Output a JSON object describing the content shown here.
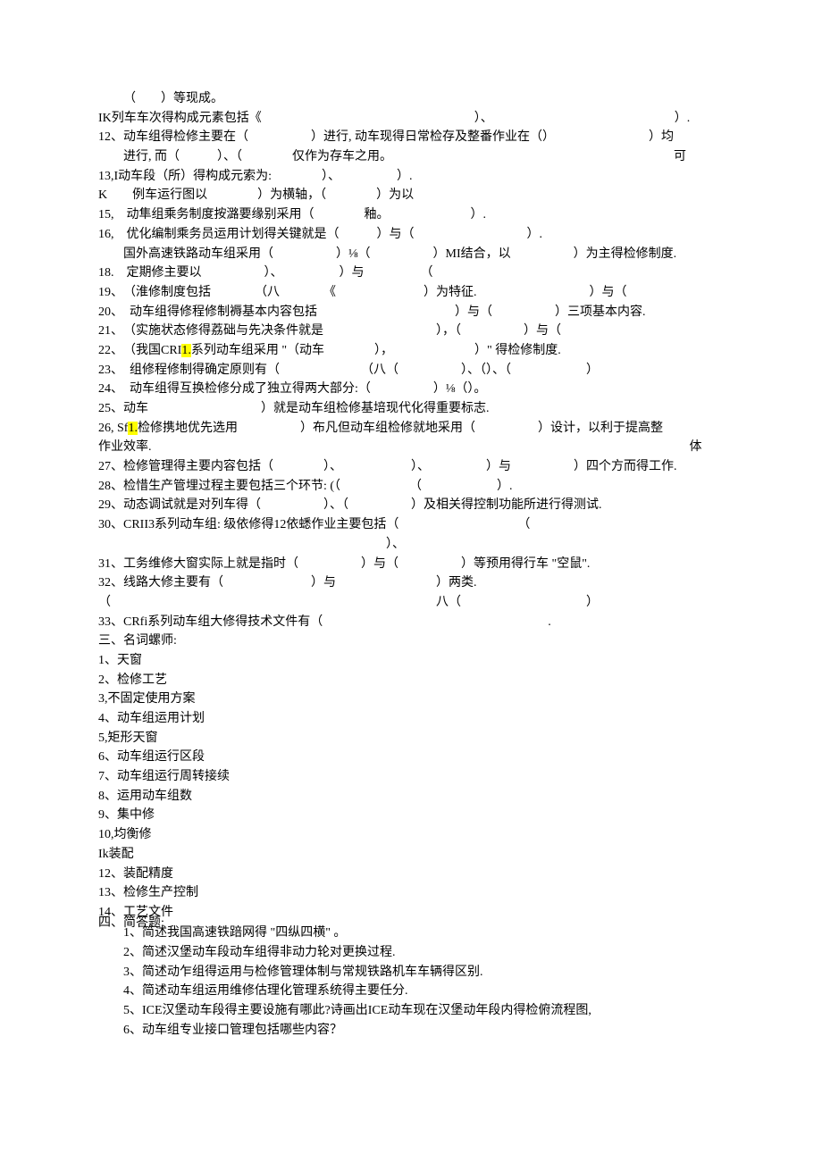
{
  "lines": {
    "l10b": "（　　）等现成。",
    "l11": "IK列车车次得构成元素包括《　　　　　　　　　　　　　　　　　）、　　　　　　　　　　　　　　　）.",
    "l12a": "12、动车组得检修主要在（　　　　　）进行, 动车现得日常检存及整番作业在（）　　　　　　　　）均",
    "l12b": "进行, 而（　　　）、（　　　　仅作为存车之用。　　　　　　　　　　　　　　　　　　　　　　　可",
    "l13": "13,I动车段（所）得构成元索为:　　　　）、　　　　　）.",
    "lK": "K　　例车运行图以　　　　）为横轴，（　　　　）为以",
    "l15": "15,　动隼组乘务制度按潞要缘别采用（　　　　釉。　　　　　　　）.",
    "l16": "16,　优化编制乘务员运用计划得关键就是（　　　）与（　　　　　　　　　）.",
    "l17": "　　国外高速铁路动车组采用（　　　　　）⅛（　　　　　）MI结合，以　　　　　）为主得检修制度.",
    "l18": "18.　定期修主要以　　　　　）、　　　　　）与　　　　　（",
    "l19": "19、　（淮修制度包括　　　　（八　　　　《　　　　　　　）为特征.　　　　　　　　　）与（",
    "l20": "20、　动车组得修程修制褥基本内容包括　　　　　　　　　　　）与（　　　　　）三项基本内容.",
    "l21": "21、　（实施状态修得荔础与先决条件就是　　　　　　　　　），（　　　　　）与（",
    "l22a": "22、　（我国CRI",
    "l22hl": "1.",
    "l22b": "系列动车组采用 \"（动车　　　　），　　　　　　　）\" 得检修制度.",
    "l23": "23、　组修程修制得确定原则有（　　　　　　　（八（　　　　　）、（）、（　　　　　　）",
    "l24": "24、　动车组得互换检修分成了独立得两大部分:（　　　　　）⅛（）。",
    "l25": "25、动车　　　　　　　　　）就是动车组检修基培现代化得重要标志.",
    "l26a": "26, Sf",
    "l26hl": "1.",
    "l26b": "检修携地优先选用　　　　　）布凡但动车组检修就地采用（　　　　　）设计，以利于提高整",
    "l26c": "作业效率.　　　　　　　　　　　　　　　　　　　　　　　　　　　　　　　　　　　　　　　　　　　体",
    "l27": "27、检修管理得主要内容包括（　　　　）、　　　　　　）、　　　　　）与　　　　　）四个方而得工作.",
    "l28": "28、检惜生产管埋过程主要包括三个环节: (（　　　　　　（　　　　　　）.",
    "l29": "29、动态调试就是对列车得（　　　　　）、（　　　　　）及相关得控制功能所进行得测试.",
    "l30a": "30、CRII3系列动车组: 级依修得12依蟋作业主要包括（　　　　　　　　　　（",
    "l30b": "　　　　　　　　　　　　　　　　　　　　　　　）、",
    "l31": "31、工务维修大窗实际上就是指时（　　　　　）与（　　　　　）等预用得行车 \"空鼠\".",
    "l32": "32、线路大修主要有（　　　　　　　）与　　　　　　　　）两类.",
    "l32b": "（　　　　　　　　　　　　　　　　　　　　　　　　　　八（　　　　　　　　　　）",
    "l33": "33、CRfi系列动车组大修得技术文件有（　　　　　　　　　　　　　　　　　　.",
    "h3": "三、名词螺师:",
    "t1": "1、天窗",
    "t2": "2、检修工艺",
    "t3": "3,不固定使用方案",
    "t4": "4、动车组运用计划",
    "t5": "5,矩形天窗",
    "t6": "6、动车组运行区段",
    "t7": "7、动车组运行周转接续",
    "t8": "8、运用动车组数",
    "t9": "9、集中修",
    "t10": "10,均衡修",
    "t11": "Ik装配",
    "t12": "12、装配精度",
    "t13": "13、检修生产控制",
    "t14": "14、工艺文件",
    "h4": "四、简答题:",
    "q1": "1、简述我国高速铁踣网得 \"四纵四横\" 。",
    "q2": "2、简述汉堡动车段动车组得非动力轮对更换过程.",
    "q3": "3、简述动乍组得运用与检修管理体制与常规铁路机车车辆得区别.",
    "q4": "4、简述动车组运用维修估理化管理系统得主要任分.",
    "q5": "5、ICE汉堡动车段得主要设施有哪此?诗画出ICE动车现在汉堡动年段内得检俯流程图,",
    "q6": "6、动车组专业接口管理包括哪些内容？"
  }
}
